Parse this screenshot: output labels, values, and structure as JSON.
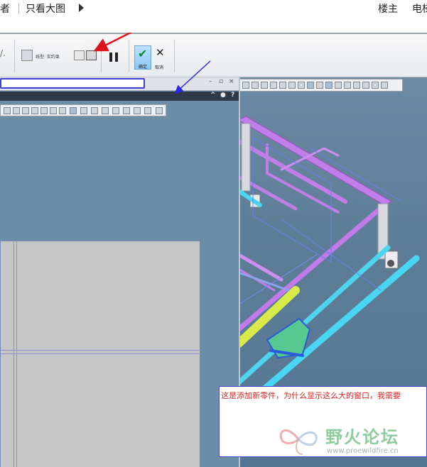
{
  "forum_bar": {
    "author_fragment": "者",
    "view_large_image": "只看大图",
    "floor_owner": "楼主",
    "right_fragment": "电梯"
  },
  "ribbon": {
    "linetype_label": "线型: 实约束",
    "ok_label": "确定",
    "cancel_label": "取消"
  },
  "subwindow": {
    "input_value": "",
    "dark_controls": "^ ● ?",
    "window_controls": "_ ▫ ×"
  },
  "annotation": {
    "text": "这是添加新零件，为什么显示这么大的窗口，我需要"
  },
  "watermark": {
    "brand": "野火论坛",
    "url": "www.proewildfire.cn"
  },
  "colors": {
    "arrow_red": "#e0141b",
    "arrow_blue": "#2a2ae6",
    "frame_purple": "#cc6cf0",
    "frame_cyan": "#48d8f0",
    "frame_yellow": "#d7ea4a",
    "annotation_red": "#e22323"
  },
  "icons": [
    "play-triangle-icon",
    "dimension-icon",
    "pause-icon",
    "check-icon",
    "close-icon",
    "window-minimize-icon",
    "window-restore-icon",
    "window-close-icon",
    "help-icon"
  ]
}
